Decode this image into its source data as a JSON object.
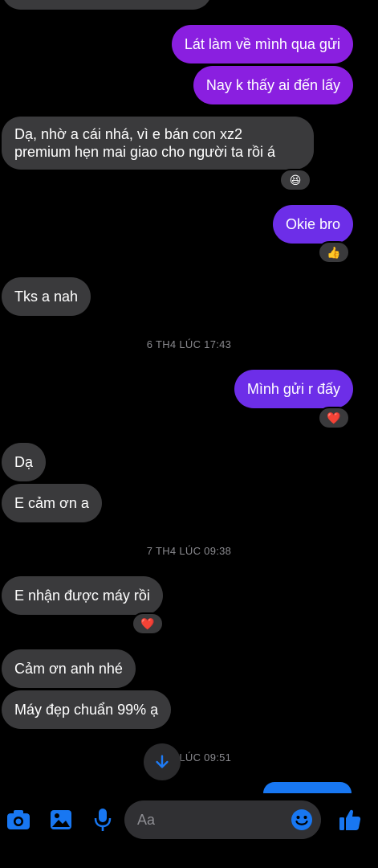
{
  "thread": {
    "top_partial_text": "",
    "messages": [
      {
        "id": "m1",
        "side": "out",
        "text": "Lát làm về mình qua gửi"
      },
      {
        "id": "m2",
        "side": "out",
        "text": "Nay k thấy ai đến lấy"
      },
      {
        "id": "m3",
        "side": "in",
        "lines": [
          "Dạ, nhờ a cái nhá, vì e bán con xz2",
          "premium hẹn mai giao cho người ta rồi á"
        ],
        "reaction": "😆"
      },
      {
        "id": "m4",
        "side": "out",
        "text": "Okie bro",
        "reaction": "👍"
      },
      {
        "id": "m5",
        "side": "in",
        "text": "Tks a nah"
      },
      {
        "id": "m6",
        "side": "out",
        "text": "Mình gửi r đấy",
        "reaction": "❤️"
      },
      {
        "id": "m7",
        "side": "in",
        "text": "Dạ"
      },
      {
        "id": "m8",
        "side": "in",
        "text": "E cảm ơn a"
      },
      {
        "id": "m9",
        "side": "in",
        "text": "E nhận được máy rồi",
        "reaction": "❤️"
      },
      {
        "id": "m10",
        "side": "in",
        "text": "Cảm ơn anh nhé"
      },
      {
        "id": "m11",
        "side": "in",
        "text": "Máy đẹp chuẩn 99% ạ"
      }
    ],
    "timestamps": {
      "t1": "6 TH4 LÚC 17:43",
      "t2": "7 TH4 LÚC 09:38",
      "t3": "7 TH4 LÚC 09:51"
    }
  },
  "composer": {
    "placeholder": "Aa",
    "icons": [
      "camera-icon",
      "gallery-icon",
      "microphone-icon",
      "emoji-icon",
      "thumbs-up-icon"
    ]
  },
  "colors": {
    "background": "#000000",
    "incoming_bubble": "#3a3a3c",
    "outgoing_purple": "#8a1fe0",
    "outgoing_violet": "#6d2ee8",
    "accent_blue": "#1877f2",
    "timestamp_text": "#8a8a8f"
  }
}
